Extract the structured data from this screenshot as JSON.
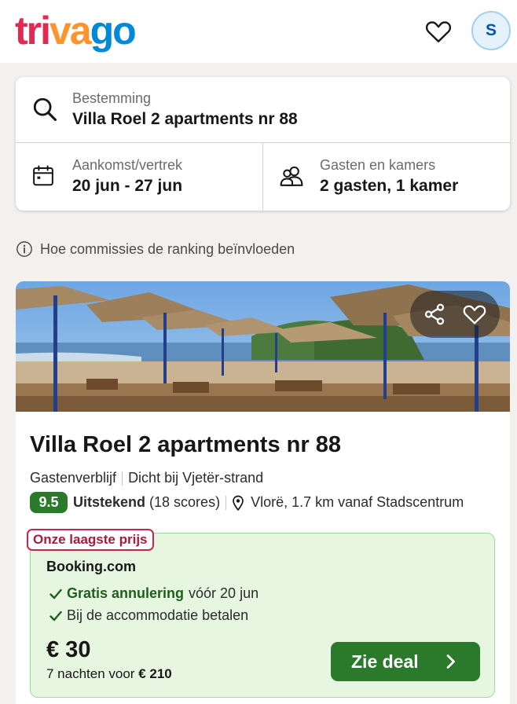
{
  "header": {
    "logo_parts": [
      "tri",
      "va",
      "go"
    ],
    "avatar_initial": "S"
  },
  "search": {
    "destination_label": "Bestemming",
    "destination_value": "Villa Roel 2 apartments nr 88",
    "dates_label": "Aankomst/vertrek",
    "dates_value": "20 jun - 27 jun",
    "guests_label": "Gasten en kamers",
    "guests_value": "2 gasten, 1 kamer"
  },
  "info": {
    "commission_text": "Hoe commissies de ranking beïnvloeden"
  },
  "hotel": {
    "name": "Villa Roel 2 apartments nr 88",
    "type": "Gastenverblijf",
    "nearby": "Dicht bij Vjetër-strand",
    "score": "9.5",
    "rating_label": "Uitstekend",
    "rating_count": "(18 scores)",
    "location": "Vlorë, 1.7 km vanaf Stadscentrum"
  },
  "deal": {
    "badge": "Onze laagste prijs",
    "provider": "Booking.com",
    "perk1_strong": "Gratis annulering",
    "perk1_rest": "vóór 20 jun",
    "perk2": "Bij de accommodatie betalen",
    "price": "€ 30",
    "nights_prefix": "7 nachten voor",
    "nights_total": "€ 210",
    "button_label": "Zie deal"
  },
  "colors": {
    "brand_red": "#e32851",
    "brand_orange": "#ff932c",
    "brand_blue": "#0088d9",
    "deal_green": "#2b7a2b",
    "badge_red": "#c2274e"
  },
  "icons": [
    "heart-icon",
    "search-icon",
    "calendar-icon",
    "people-icon",
    "info-icon",
    "share-icon",
    "heart-icon",
    "map-pin-icon",
    "check-icon",
    "chevron-right-icon"
  ]
}
